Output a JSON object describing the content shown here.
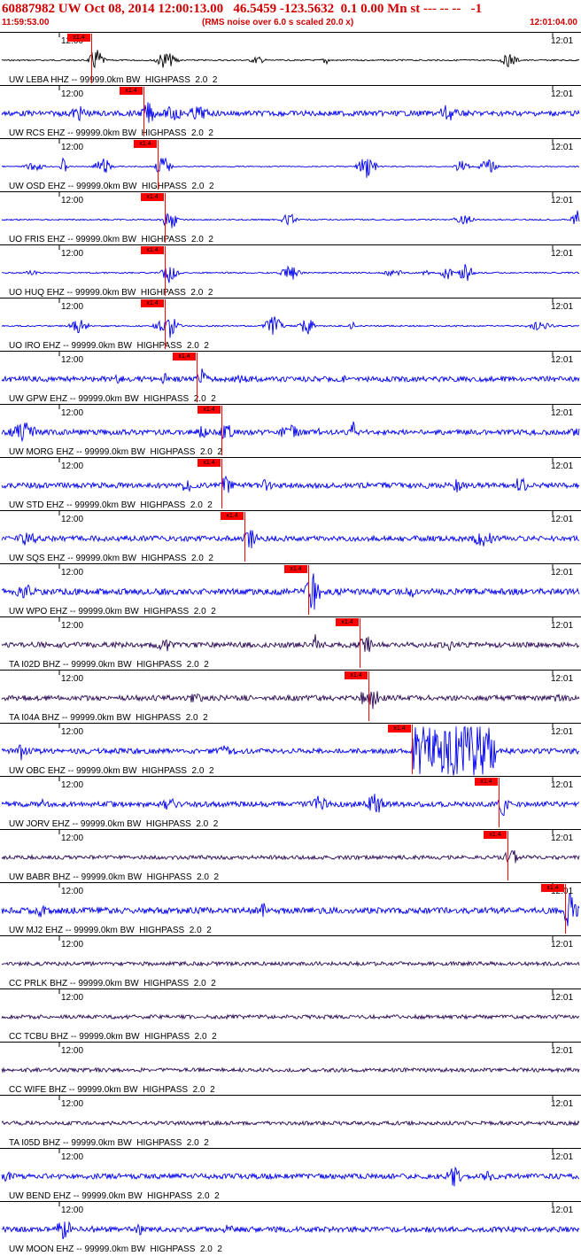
{
  "header": {
    "title": "60887982 UW Oct 08, 2014 12:00:13.00   46.5459 -123.5632  0.1 0.00 Mn st --- -- --   -1",
    "start_time": "11:59:53.00",
    "note": "(RMS noise over 6.0 s scaled 20.0 x)",
    "end_time": "12:01:04.00"
  },
  "colors": {
    "header": "#d00000",
    "pick": "#ff0000",
    "blue": "#0000ee",
    "black": "#000000",
    "purple": "#2a0a55"
  },
  "time_labels": {
    "left": "12:00",
    "right": "12:01"
  },
  "pick_label": "x1.4",
  "traces": [
    {
      "label": "UW LEBA HHZ -- 99999.0km BW  HIGHPASS  2.0  2",
      "color": "black",
      "pick": 0.155,
      "style": "spiky"
    },
    {
      "label": "UW RCS EHZ -- 99999.0km BW  HIGHPASS  2.0  2",
      "color": "blue",
      "pick": 0.245,
      "style": "noisy"
    },
    {
      "label": "UW OSD EHZ -- 99999.0km BW  HIGHPASS  2.0  2",
      "color": "blue",
      "pick": 0.27,
      "style": "quiet"
    },
    {
      "label": "UO FRIS EHZ -- 99999.0km BW  HIGHPASS  2.0  2",
      "color": "blue",
      "pick": 0.282,
      "style": "spiky"
    },
    {
      "label": "UO HUQ EHZ -- 99999.0km BW  HIGHPASS  2.0  2",
      "color": "blue",
      "pick": 0.282,
      "style": "spiky"
    },
    {
      "label": "UO IRO EHZ -- 99999.0km BW  HIGHPASS  2.0  2",
      "color": "blue",
      "pick": 0.282,
      "style": "spiky"
    },
    {
      "label": "UW GPW EHZ -- 99999.0km BW  HIGHPASS  2.0  2",
      "color": "blue",
      "pick": 0.338,
      "style": "noisy"
    },
    {
      "label": "UW MORG EHZ -- 99999.0km BW  HIGHPASS  2.0  2",
      "color": "blue",
      "pick": 0.38,
      "style": "noisy"
    },
    {
      "label": "UW STD EHZ -- 99999.0km BW  HIGHPASS  2.0  2",
      "color": "blue",
      "pick": 0.38,
      "style": "noisy"
    },
    {
      "label": "UW SQS EHZ -- 99999.0km BW  HIGHPASS  2.0  2",
      "color": "blue",
      "pick": 0.42,
      "style": "noisy"
    },
    {
      "label": "UW WPO EHZ -- 99999.0km BW  HIGHPASS  2.0  2",
      "color": "blue",
      "pick": 0.53,
      "style": "loud"
    },
    {
      "label": "TA I02D BHZ -- 99999.0km BW  HIGHPASS  2.0  2",
      "color": "purple",
      "pick": 0.62,
      "style": "noisy"
    },
    {
      "label": "TA I04A BHZ -- 99999.0km BW  HIGHPASS  2.0  2",
      "color": "purple",
      "pick": 0.635,
      "style": "noisy"
    },
    {
      "label": "UW OBC EHZ -- 99999.0km BW  HIGHPASS  2.0  2",
      "color": "blue",
      "pick": 0.71,
      "style": "block"
    },
    {
      "label": "UW JORV EHZ -- 99999.0km BW  HIGHPASS  2.0  2",
      "color": "blue",
      "pick": 0.86,
      "style": "noisy"
    },
    {
      "label": "UW BABR BHZ -- 99999.0km BW  HIGHPASS  2.0  2",
      "color": "purple",
      "pick": 0.875,
      "style": "quietnoise"
    },
    {
      "label": "UW MJ2 EHZ -- 99999.0km BW  HIGHPASS  2.0  2",
      "color": "blue",
      "pick": 0.975,
      "style": "loud"
    },
    {
      "label": "CC PRLK BHZ -- 99999.0km BW  HIGHPASS  2.0  2",
      "color": "purple",
      "pick": null,
      "style": "quietnoise"
    },
    {
      "label": "CC TCBU BHZ -- 99999.0km BW  HIGHPASS  2.0  2",
      "color": "purple",
      "pick": null,
      "style": "quietnoise"
    },
    {
      "label": "CC WIFE BHZ -- 99999.0km BW  HIGHPASS  2.0  2",
      "color": "purple",
      "pick": null,
      "style": "quietnoise"
    },
    {
      "label": "TA I05D BHZ -- 99999.0km BW  HIGHPASS  2.0  2",
      "color": "purple",
      "pick": null,
      "style": "quietnoise"
    },
    {
      "label": "UW BEND EHZ -- 99999.0km BW  HIGHPASS  2.0  2",
      "color": "blue",
      "pick": null,
      "style": "noisy"
    },
    {
      "label": "UW MOON EHZ -- 99999.0km BW  HIGHPASS  2.0  2",
      "color": "blue",
      "pick": null,
      "style": "noisy"
    }
  ]
}
